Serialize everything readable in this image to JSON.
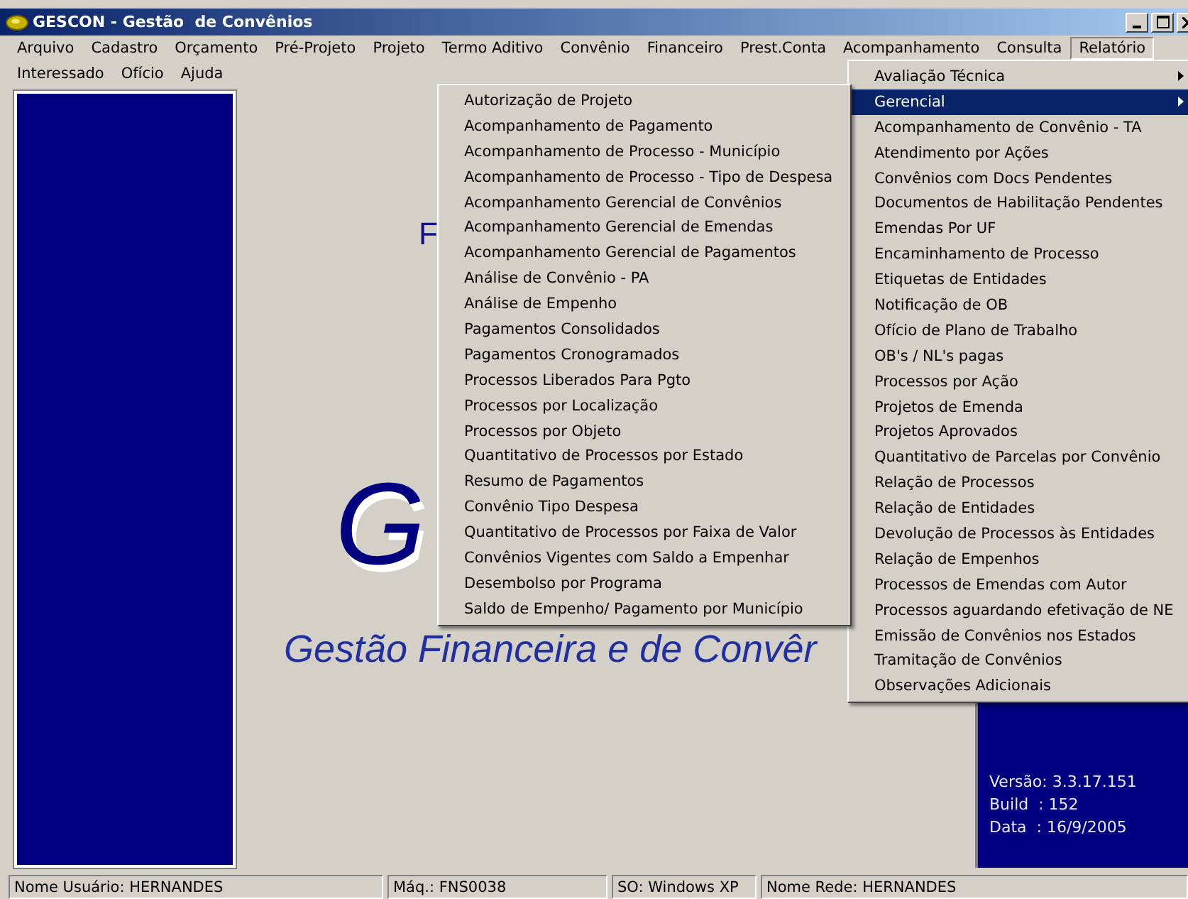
{
  "window": {
    "title": "GESCON - Gestão  de Convênios"
  },
  "menu_bar": [
    {
      "label": "Arquivo",
      "selected": false
    },
    {
      "label": "Cadastro",
      "selected": false
    },
    {
      "label": "Orçamento",
      "selected": false
    },
    {
      "label": "Pré-Projeto",
      "selected": false
    },
    {
      "label": "Projeto",
      "selected": false
    },
    {
      "label": "Termo Aditivo",
      "selected": false
    },
    {
      "label": "Convênio",
      "selected": false
    },
    {
      "label": "Financeiro",
      "selected": false
    },
    {
      "label": "Prest.Conta",
      "selected": false
    },
    {
      "label": "Acompanhamento",
      "selected": false
    },
    {
      "label": "Consulta",
      "selected": false
    },
    {
      "label": "Relatório",
      "selected": true
    },
    {
      "label": "Interessado",
      "selected": false
    },
    {
      "label": "Ofício",
      "selected": false
    },
    {
      "label": "Ajuda",
      "selected": false
    }
  ],
  "splash": {
    "letter_f": "F",
    "letter_g": "G",
    "subtitle": "Gestão Financeira e de Convêr",
    "version_lines": [
      "Versão: 3.3.17.151",
      "Build  : 152",
      "Data  : 16/9/2005"
    ]
  },
  "relatorio_menu": [
    {
      "label": "Avaliação Técnica",
      "submenu": true,
      "selected": false
    },
    {
      "label": "Gerencial",
      "submenu": true,
      "selected": true
    },
    {
      "label": "Acompanhamento de Convênio - TA",
      "submenu": false,
      "selected": false
    },
    {
      "label": "Atendimento por Ações",
      "submenu": false,
      "selected": false
    },
    {
      "label": "Convênios com Docs Pendentes",
      "submenu": false,
      "selected": false
    },
    {
      "label": "Documentos de Habilitação Pendentes",
      "submenu": false,
      "selected": false
    },
    {
      "label": "Emendas Por UF",
      "submenu": false,
      "selected": false
    },
    {
      "label": "Encaminhamento de Processo",
      "submenu": false,
      "selected": false
    },
    {
      "label": "Etiquetas de Entidades",
      "submenu": false,
      "selected": false
    },
    {
      "label": "Notificação de OB",
      "submenu": false,
      "selected": false
    },
    {
      "label": "Ofício de Plano de Trabalho",
      "submenu": false,
      "selected": false
    },
    {
      "label": "OB's / NL's pagas",
      "submenu": false,
      "selected": false
    },
    {
      "label": "Processos por Ação",
      "submenu": false,
      "selected": false
    },
    {
      "label": "Projetos de Emenda",
      "submenu": false,
      "selected": false
    },
    {
      "label": "Projetos Aprovados",
      "submenu": false,
      "selected": false
    },
    {
      "label": "Quantitativo de Parcelas por Convênio",
      "submenu": false,
      "selected": false
    },
    {
      "label": "Relação de Processos",
      "submenu": false,
      "selected": false
    },
    {
      "label": "Relação de Entidades",
      "submenu": false,
      "selected": false
    },
    {
      "label": "Devolução de Processos às Entidades",
      "submenu": false,
      "selected": false
    },
    {
      "label": "Relação de Empenhos",
      "submenu": false,
      "selected": false
    },
    {
      "label": "Processos de Emendas com Autor",
      "submenu": false,
      "selected": false
    },
    {
      "label": "Processos aguardando efetivação de NE",
      "submenu": false,
      "selected": false
    },
    {
      "label": "Emissão de Convênios nos Estados",
      "submenu": false,
      "selected": false
    },
    {
      "label": "Tramitação de Convênios",
      "submenu": false,
      "selected": false
    },
    {
      "label": "Observações Adicionais",
      "submenu": false,
      "selected": false
    }
  ],
  "gerencial_submenu": [
    "Autorização de Projeto",
    "Acompanhamento de Pagamento",
    "Acompanhamento de Processo - Município",
    "Acompanhamento de Processo - Tipo de Despesa",
    "Acompanhamento Gerencial de Convênios",
    "Acompanhamento Gerencial de Emendas",
    "Acompanhamento Gerencial de Pagamentos",
    "Análise de Convênio - PA",
    "Análise de Empenho",
    "Pagamentos Consolidados",
    "Pagamentos Cronogramados",
    "Processos Liberados Para Pgto",
    "Processos por Localização",
    "Processos por Objeto",
    "Quantitativo de Processos por Estado",
    "Resumo de Pagamentos",
    "Convênio Tipo Despesa",
    "Quantitativo de Processos por Faixa de Valor",
    "Convênios Vigentes com Saldo a Empenhar",
    "Desembolso por Programa",
    "Saldo de Empenho/ Pagamento por Município"
  ],
  "status_bar": [
    "Nome Usuário: HERNANDES",
    "Máq.: FNS0038",
    "SO: Windows XP",
    "Nome Rede: HERNANDES"
  ]
}
